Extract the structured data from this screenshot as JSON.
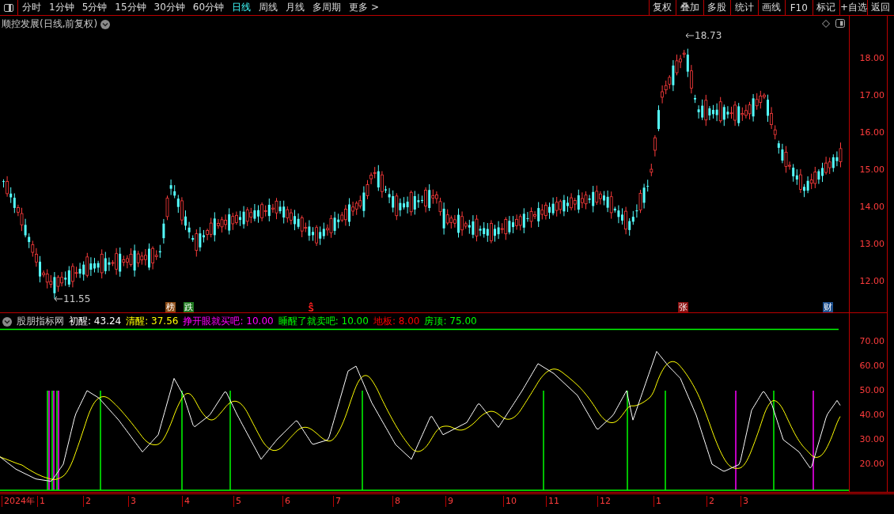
{
  "toolbar": {
    "periods": [
      {
        "label": "分时",
        "selected": false
      },
      {
        "label": "1分钟",
        "selected": false
      },
      {
        "label": "5分钟",
        "selected": false
      },
      {
        "label": "15分钟",
        "selected": false
      },
      {
        "label": "30分钟",
        "selected": false
      },
      {
        "label": "60分钟",
        "selected": false
      },
      {
        "label": "日线",
        "selected": true
      },
      {
        "label": "周线",
        "selected": false
      },
      {
        "label": "月线",
        "selected": false
      },
      {
        "label": "多周期",
        "selected": false
      },
      {
        "label": "更多 >",
        "selected": false
      }
    ],
    "buttons": [
      "复权",
      "叠加",
      "多股",
      "统计",
      "画线",
      "F10",
      "标记",
      "+自选",
      "返回"
    ]
  },
  "price_chart": {
    "title": "顺控发展(日线,前复权)",
    "high_label": "18.73",
    "low_label": "11.55",
    "markers": [
      {
        "text": "榜",
        "color": "#8b4a14"
      },
      {
        "text": "跌",
        "color": "#1f7a1f"
      },
      {
        "text": "张",
        "color": "#8b1010"
      },
      {
        "text": "财",
        "color": "#1c4e8c"
      }
    ],
    "axis": [
      "18.00",
      "17.00",
      "16.00",
      "15.00",
      "14.00",
      "13.00",
      "12.00"
    ]
  },
  "indicator": {
    "name": "股朋指标网",
    "values": [
      {
        "label": "初醒:",
        "value": "43.24",
        "color": "#ffffff"
      },
      {
        "label": "清醒:",
        "value": "37.56",
        "color": "#ffff00"
      },
      {
        "label": "挣开眼就买吧:",
        "value": "10.00",
        "color": "#ff00ff"
      },
      {
        "label": "睡醒了就卖吧:",
        "value": "10.00",
        "color": "#00ff00"
      },
      {
        "label": "地板:",
        "value": "8.00",
        "color": "#ff0000"
      },
      {
        "label": "房顶:",
        "value": "75.00",
        "color": "#00ff00"
      }
    ],
    "axis": [
      "70.00",
      "60.00",
      "50.00",
      "40.00",
      "30.00",
      "20.00"
    ]
  },
  "time_axis": [
    "2024年",
    "1",
    "2",
    "3",
    "4",
    "5",
    "6",
    "7",
    "8",
    "9",
    "10",
    "11",
    "12",
    "1",
    "2",
    "3"
  ]
}
